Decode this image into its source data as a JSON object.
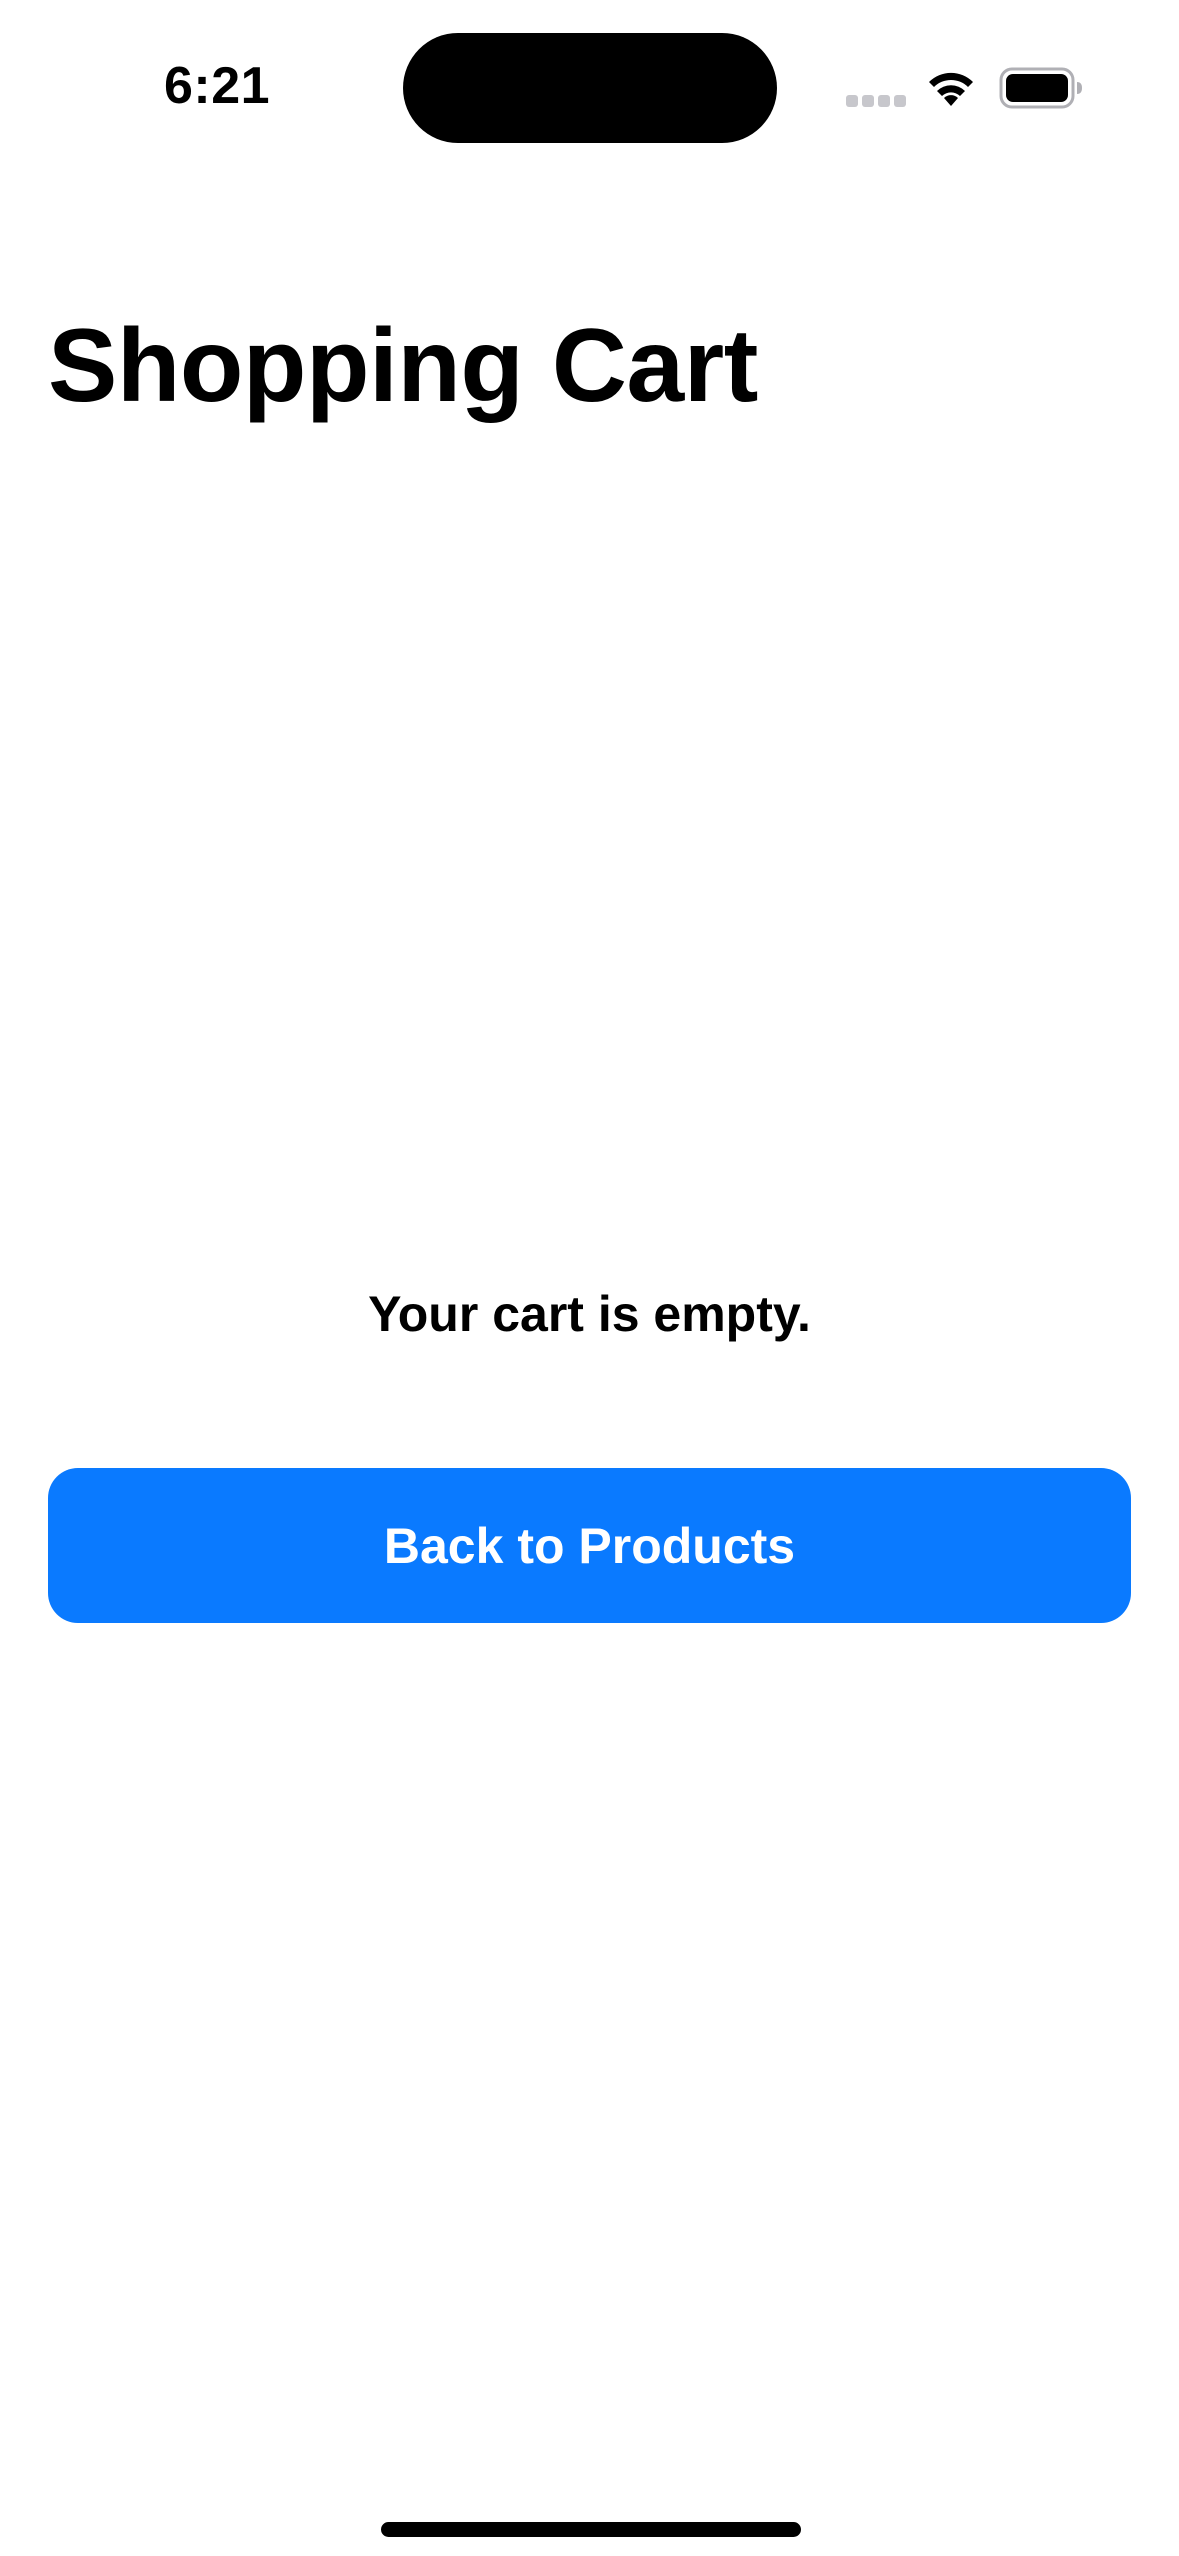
{
  "status_bar": {
    "time": "6:21"
  },
  "header": {
    "title": "Shopping Cart"
  },
  "cart": {
    "empty_message": "Your cart is empty."
  },
  "actions": {
    "back_button_label": "Back to Products"
  },
  "colors": {
    "accent": "#0a7aff",
    "background": "#ffffff",
    "text": "#000000"
  },
  "icons": [
    "cellular-signal-icon",
    "wifi-icon",
    "battery-icon"
  ]
}
